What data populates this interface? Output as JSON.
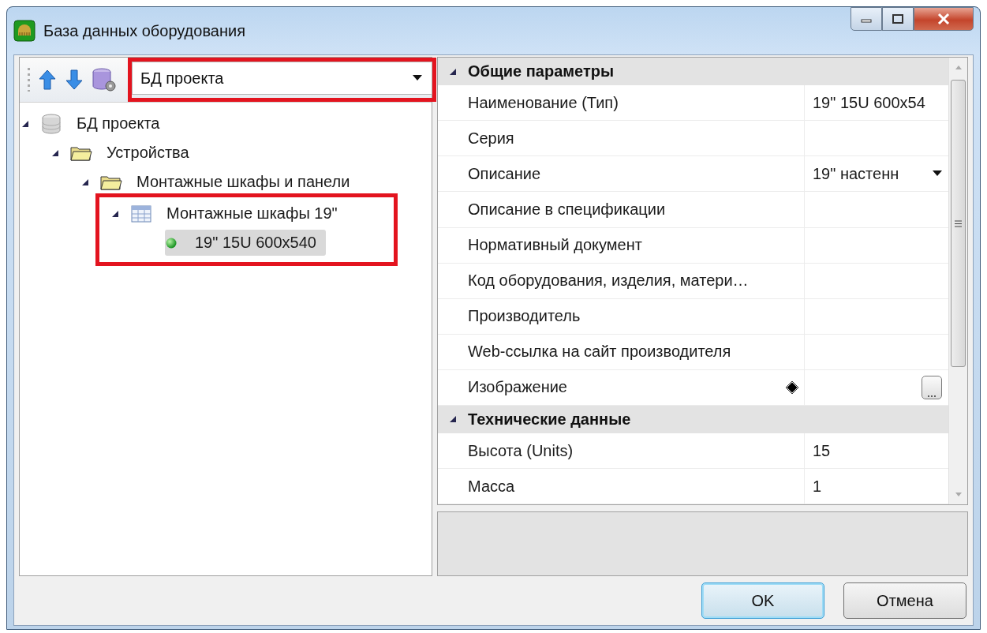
{
  "window": {
    "title": "База данных оборудования"
  },
  "source": {
    "value": "БД проекта",
    "highlighted": true
  },
  "tree": [
    {
      "label": "БД проекта",
      "kind": "database",
      "expanded": true,
      "selected": false,
      "highlighted": false,
      "children": [
        {
          "label": "Устройства",
          "kind": "folder",
          "expanded": true,
          "selected": false,
          "highlighted": false,
          "children": [
            {
              "label": "Монтажные шкафы и панели",
              "kind": "folder",
              "expanded": true,
              "selected": false,
              "highlighted": false,
              "children": [
                {
                  "label": "Монтажные шкафы 19\"",
                  "kind": "table",
                  "expanded": true,
                  "selected": false,
                  "highlighted": true,
                  "children": [
                    {
                      "label": "19\" 15U 600x540",
                      "kind": "item",
                      "selected": true,
                      "highlighted": false
                    }
                  ]
                }
              ]
            }
          ]
        }
      ]
    }
  ],
  "properties": [
    {
      "category": "Общие параметры",
      "expanded": true,
      "rows": [
        {
          "name": "Наименование (Тип)",
          "value": "19\" 15U 600x54",
          "kind": "text",
          "modified": false
        },
        {
          "name": "Серия",
          "kind": "text",
          "modified": false
        },
        {
          "name": "Описание",
          "value": "19\" настенн",
          "kind": "dropdown",
          "modified": false
        },
        {
          "name": "Описание в спецификации",
          "kind": "text",
          "modified": false
        },
        {
          "name": "Нормативный документ",
          "kind": "text",
          "modified": false
        },
        {
          "name": "Код оборудования, изделия, матери…",
          "kind": "text",
          "modified": false
        },
        {
          "name": "Производитель",
          "kind": "text",
          "modified": false
        },
        {
          "name": "Web-ссылка на сайт производителя",
          "kind": "text",
          "modified": false
        },
        {
          "name": "Изображение",
          "kind": "button",
          "modified": true
        }
      ]
    },
    {
      "category": "Технические данные",
      "expanded": true,
      "rows": [
        {
          "name": "Высота (Units)",
          "value": "15",
          "kind": "text",
          "modified": false
        },
        {
          "name": "Масса",
          "value": "1",
          "kind": "text",
          "modified": false
        }
      ]
    }
  ],
  "buttons": [
    {
      "label": "OK",
      "default": true
    },
    {
      "label": "Отмена",
      "default": false
    }
  ]
}
